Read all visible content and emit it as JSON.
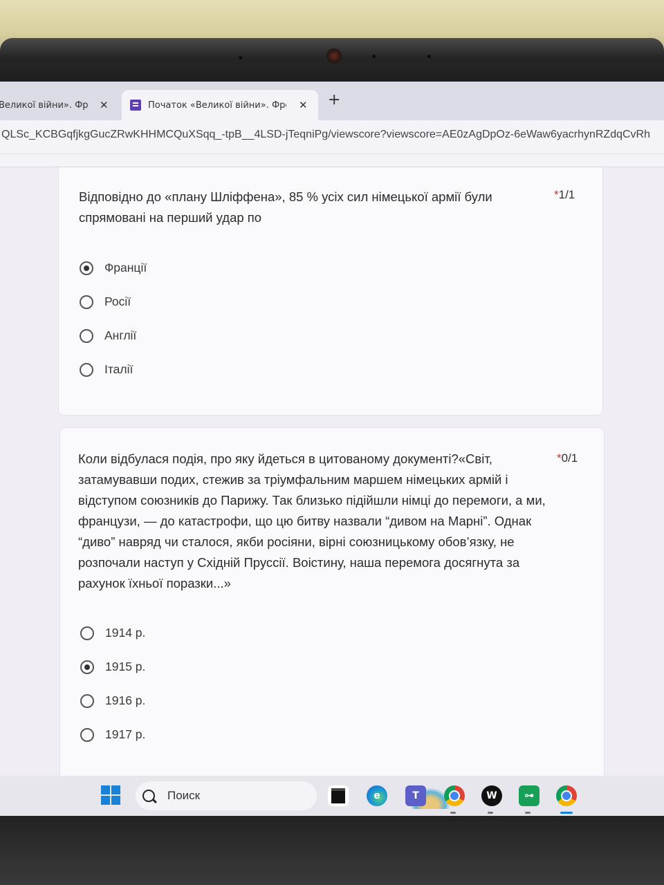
{
  "browser": {
    "tabs": [
      {
        "title": "Великої війни». Фро",
        "close": "✕"
      },
      {
        "title": "Початок «Великої війни». Фро",
        "close": "✕"
      }
    ],
    "new_tab": "+",
    "url": "QLSc_KCBGqfjkgGucZRwKHHMCQuXSqq_-tpB__4LSD-jTeqniPg/viewscore?viewscore=AE0zAgDpOz-6eWaw6yacrhynRZdqCvRh"
  },
  "questions": [
    {
      "text": "Відповідно до «плану Шліффена», 85 % усіх сил німецької армії були спрямовані на перший удар по",
      "required": "*",
      "score": "1/1",
      "options": [
        {
          "label": "Франції",
          "selected": true
        },
        {
          "label": "Росії",
          "selected": false
        },
        {
          "label": "Англії",
          "selected": false
        },
        {
          "label": "Італії",
          "selected": false
        }
      ]
    },
    {
      "text": "Коли відбулася подія, про яку йдеться в цитованому документі?«Світ, затамувавши подих, стежив за тріумфальним маршем німецьких армій і відступом союзників до Парижу. Так близько підійшли німці до перемоги, а ми, французи, — до катастрофи, що цю битву назвали “дивом на Марні”. Однак “диво” навряд чи сталося, якби росіяни, вірні союзницькому обов’язку, не розпочали наступ у Східній Пруссії. Воістину, наша перемога досягнута за рахунок їхньої поразки...»",
      "required": "*",
      "score": "0/1",
      "options": [
        {
          "label": "1914 р.",
          "selected": false
        },
        {
          "label": "1915 р.",
          "selected": true
        },
        {
          "label": "1916 р.",
          "selected": false
        },
        {
          "label": "1917 р.",
          "selected": false
        }
      ]
    }
  ],
  "taskbar": {
    "search_label": "Поиск",
    "apps": [
      "file-explorer-icon",
      "edge-icon",
      "teams-icon",
      "chrome-profile-icon",
      "w-app-icon",
      "key-app-icon",
      "chrome-icon"
    ]
  },
  "colors": {
    "forms_purple": "#5e3fb5",
    "required_star": "#c0392b",
    "windows_blue": "#1a82d6"
  }
}
